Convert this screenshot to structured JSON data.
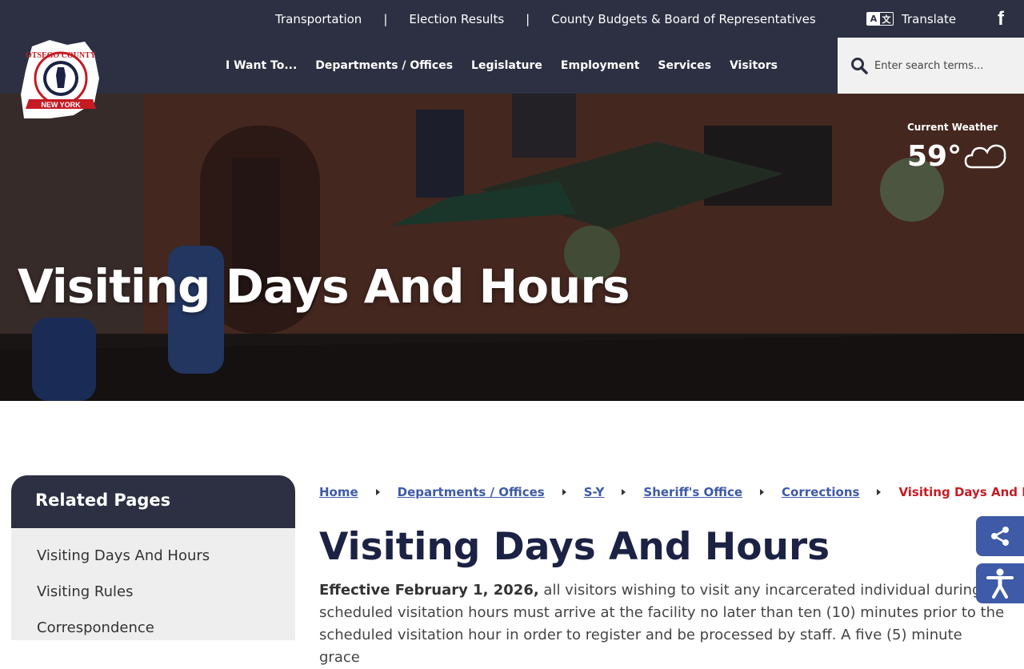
{
  "utility_bar": {
    "links": [
      "Transportation",
      "Election Results",
      "County Budgets & Board of Representatives"
    ],
    "separator": "|",
    "translate_label": "Translate",
    "translate_glyphs": [
      "A",
      "文"
    ],
    "facebook_glyph": "f"
  },
  "logo": {
    "top_text": "OTSEGO COUNTY",
    "ribbon_text": "NEW YORK"
  },
  "nav": {
    "items": [
      "I Want To...",
      "Departments / Offices",
      "Legislature",
      "Employment",
      "Services",
      "Visitors"
    ],
    "search_placeholder": "Enter search terms..."
  },
  "hero": {
    "title": "Visiting Days And Hours",
    "weather_label": "Current Weather",
    "weather_temp": "59°"
  },
  "sidebar": {
    "title": "Related Pages",
    "items": [
      "Visiting Days And Hours",
      "Visiting Rules",
      "Correspondence"
    ]
  },
  "breadcrumb": {
    "links": [
      "Home",
      "Departments / Offices",
      "S-Y",
      "Sheriff's Office",
      "Corrections"
    ],
    "current": "Visiting Days And Hours"
  },
  "content": {
    "title": "Visiting Days And Hours",
    "intro_bold": "Effective February  1, 2026,",
    "intro_text": " all visitors wishing to visit any incarcerated individual during scheduled visitation hours must arrive at the facility no later than ten (10) minutes prior to the scheduled visitation hour in order to register and be processed by staff. A five (5) minute grace"
  },
  "colors": {
    "navy": "#2c3042",
    "accent_blue": "#3f5aa6",
    "breadcrumb_current": "#c41b24",
    "title": "#1c2244"
  },
  "icons": {
    "search": "search-icon",
    "share": "share-icon",
    "accessibility": "accessibility-icon",
    "weather": "cloud-icon",
    "facebook": "facebook-icon",
    "translate": "translate-icon"
  }
}
